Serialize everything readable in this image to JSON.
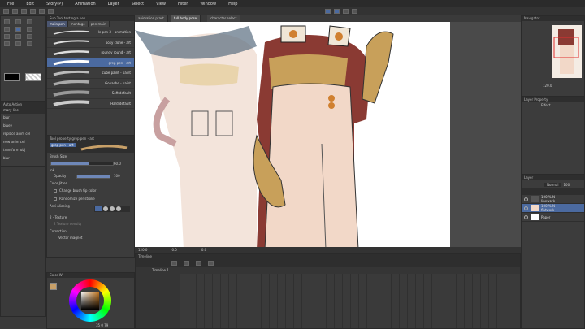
{
  "menu": [
    "File",
    "Edit",
    "Story(P)",
    "Animation",
    "Layer",
    "Select",
    "View",
    "Filter",
    "Window",
    "Help"
  ],
  "doc_tabs": [
    {
      "label": "animation pract",
      "active": false
    },
    {
      "label": "full body pose",
      "active": true
    },
    {
      "label": "character select",
      "active": false
    }
  ],
  "sub_tool": {
    "header": "Sub Tool testing a pen",
    "tabs": [
      "main pen",
      "montage",
      "pen main"
    ],
    "brushes": [
      {
        "label": "le pen 3 - animation",
        "selected": false
      },
      {
        "label": "boxy clone - art",
        "selected": false
      },
      {
        "label": "roundy round - art",
        "selected": false
      },
      {
        "label": "grep pen - art",
        "selected": true
      },
      {
        "label": "cube paint - paint",
        "selected": false
      },
      {
        "label": "Gouache - paint",
        "selected": false
      },
      {
        "label": "Soft default",
        "selected": false
      },
      {
        "label": "Hard default",
        "selected": false
      }
    ]
  },
  "auto_action": {
    "header": "Auto Action",
    "set": "mary line",
    "items": [
      "blur",
      "bluey",
      "replace anim cel",
      "new anim cel",
      "transform obj",
      "blur"
    ]
  },
  "tool_property": {
    "header": "Tool property grep pen - art",
    "preset": "grep pen - art",
    "brush_size_label": "Brush Size",
    "brush_size_value": "60.0",
    "brush_size_fraction": 0.6,
    "ink_label": "Ink",
    "opacity_label": "Opacity",
    "opacity_value": "100",
    "color_jitter_label": "Color Jitter",
    "change_tip_label": "Change brush tip color",
    "randomize_label": "Randomize per stroke",
    "anti_aliasing_label": "Anti-aliasing",
    "texture_label": "2 - Texture",
    "texture_density_label": "2 Texture density",
    "correction_label": "Correction",
    "vector_magnet_label": "Vector magnet"
  },
  "color": {
    "header": "Color W",
    "readout": "35  0  79",
    "main_color": "#c8a068"
  },
  "canvas": {
    "zoom": "120.0",
    "angle": "0.0",
    "bottom_value": "0.0"
  },
  "timeline": {
    "header": "Timeline",
    "track_label": "Timeline 1"
  },
  "navigator": {
    "header": "Navigator",
    "zoom": "120.0"
  },
  "layer_property": {
    "header": "Layer Property",
    "effect_label": "Effect"
  },
  "layers": {
    "header": "Layer",
    "blend": "Normal",
    "opacity": "100",
    "rows": [
      {
        "label": "100 % N",
        "sub": "linework"
      },
      {
        "label": "100 % N",
        "sub": "flatwork"
      },
      {
        "label": "Paper",
        "sub": ""
      }
    ]
  },
  "colors": {
    "accent": "#4b6aa0",
    "canvas_bg": "#ffffff",
    "red_figure": "#8a3a33",
    "gold": "#c8a05a",
    "cream": "#f2d8c8"
  }
}
